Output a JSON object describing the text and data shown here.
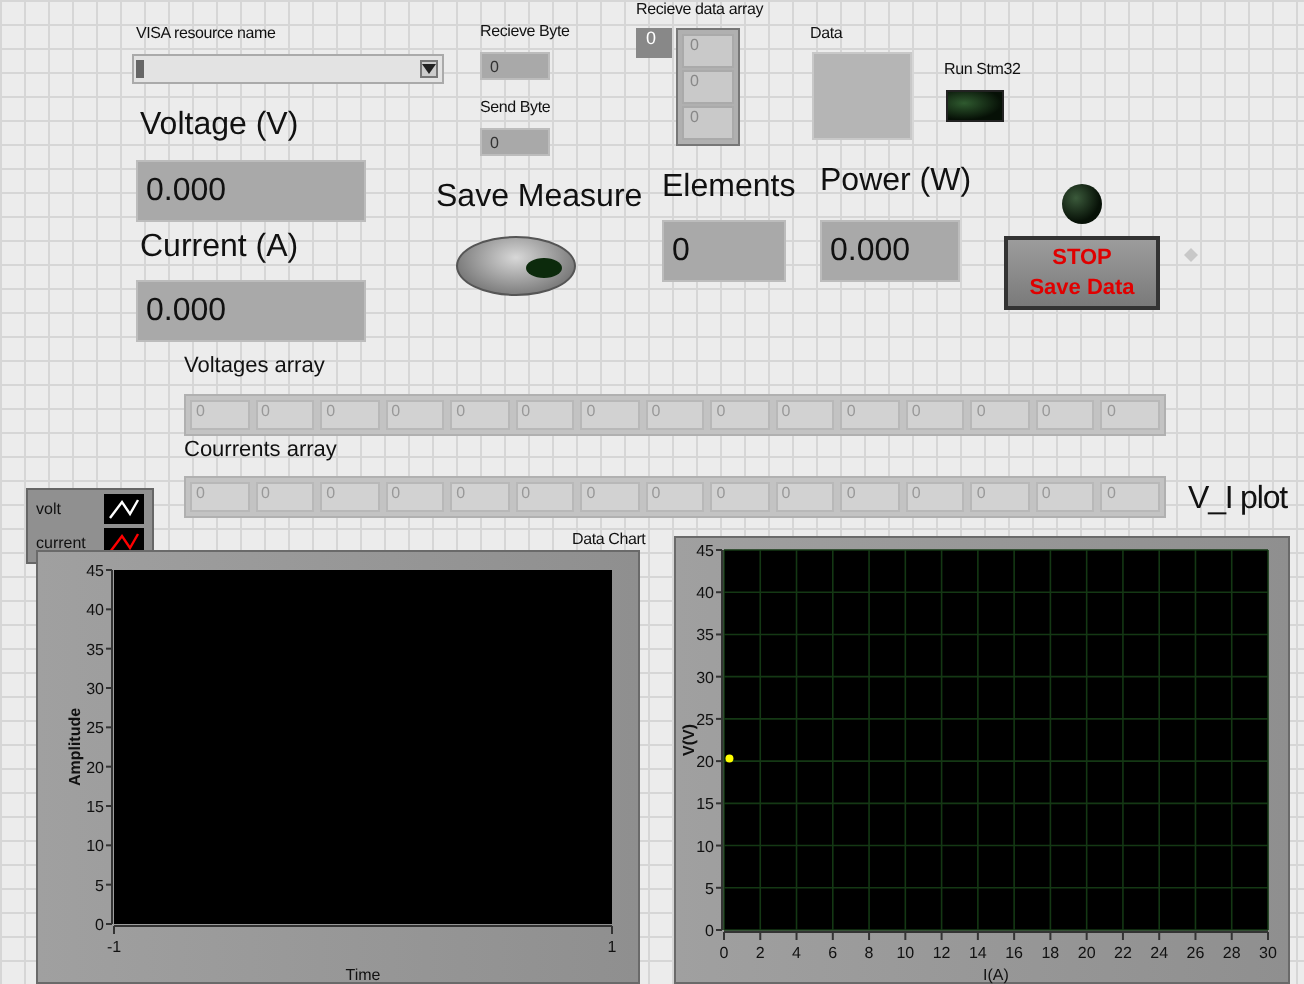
{
  "visa": {
    "label": "VISA resource name"
  },
  "receive_byte": {
    "label": "Recieve Byte",
    "value": "0"
  },
  "send_byte": {
    "label": "Send Byte",
    "value": "0"
  },
  "receive_array": {
    "label": "Recieve data array",
    "index": "0",
    "values": [
      "0",
      "0",
      "0"
    ]
  },
  "data": {
    "label": "Data"
  },
  "run_led": {
    "label": "Run Stm32",
    "on": false
  },
  "voltage": {
    "label": "Voltage (V)",
    "value": "0.000"
  },
  "current": {
    "label": "Current (A)",
    "value": "0.000"
  },
  "save_measure": {
    "label": "Save Measure",
    "on": false
  },
  "elements": {
    "label": "Elements",
    "value": "0"
  },
  "power": {
    "label": "Power (W)",
    "value": "0.000"
  },
  "status_led": {
    "on": false
  },
  "stop_button": {
    "lines": [
      "STOP",
      "Save Data"
    ]
  },
  "voltages_array": {
    "label": "Voltages array",
    "values": [
      "0",
      "0",
      "0",
      "0",
      "0",
      "0",
      "0",
      "0",
      "0",
      "0",
      "0",
      "0",
      "0",
      "0",
      "0"
    ]
  },
  "currents_array": {
    "label": "Courrents array",
    "values": [
      "0",
      "0",
      "0",
      "0",
      "0",
      "0",
      "0",
      "0",
      "0",
      "0",
      "0",
      "0",
      "0",
      "0",
      "0"
    ]
  },
  "legend": [
    {
      "name": "volt",
      "color": "#ffffff"
    },
    {
      "name": "current",
      "color": "#ff0000"
    }
  ],
  "data_chart": {
    "chart_data": {
      "type": "line",
      "title": "Data Chart",
      "xlabel": "Time",
      "ylabel": "Amplitude",
      "xlim": [
        -1,
        1
      ],
      "ylim": [
        0,
        45
      ],
      "xticks": [
        -1,
        1
      ],
      "yticks": [
        0,
        5,
        10,
        15,
        20,
        25,
        30,
        35,
        40,
        45
      ]
    }
  },
  "vi_plot": {
    "label": "V_I plot",
    "chart_data": {
      "type": "scatter",
      "xlabel": "I(A)",
      "ylabel": "V(V)",
      "x": [
        0.3
      ],
      "series": [
        {
          "color": "#ffff00",
          "values": [
            20.3
          ]
        }
      ],
      "grid": true,
      "xlim": [
        0,
        30
      ],
      "ylim": [
        0,
        45
      ],
      "xticks": [
        0,
        2,
        4,
        6,
        8,
        10,
        12,
        14,
        16,
        18,
        20,
        22,
        24,
        26,
        28,
        30
      ],
      "yticks": [
        0,
        5,
        10,
        15,
        20,
        25,
        30,
        35,
        40,
        45
      ]
    }
  }
}
